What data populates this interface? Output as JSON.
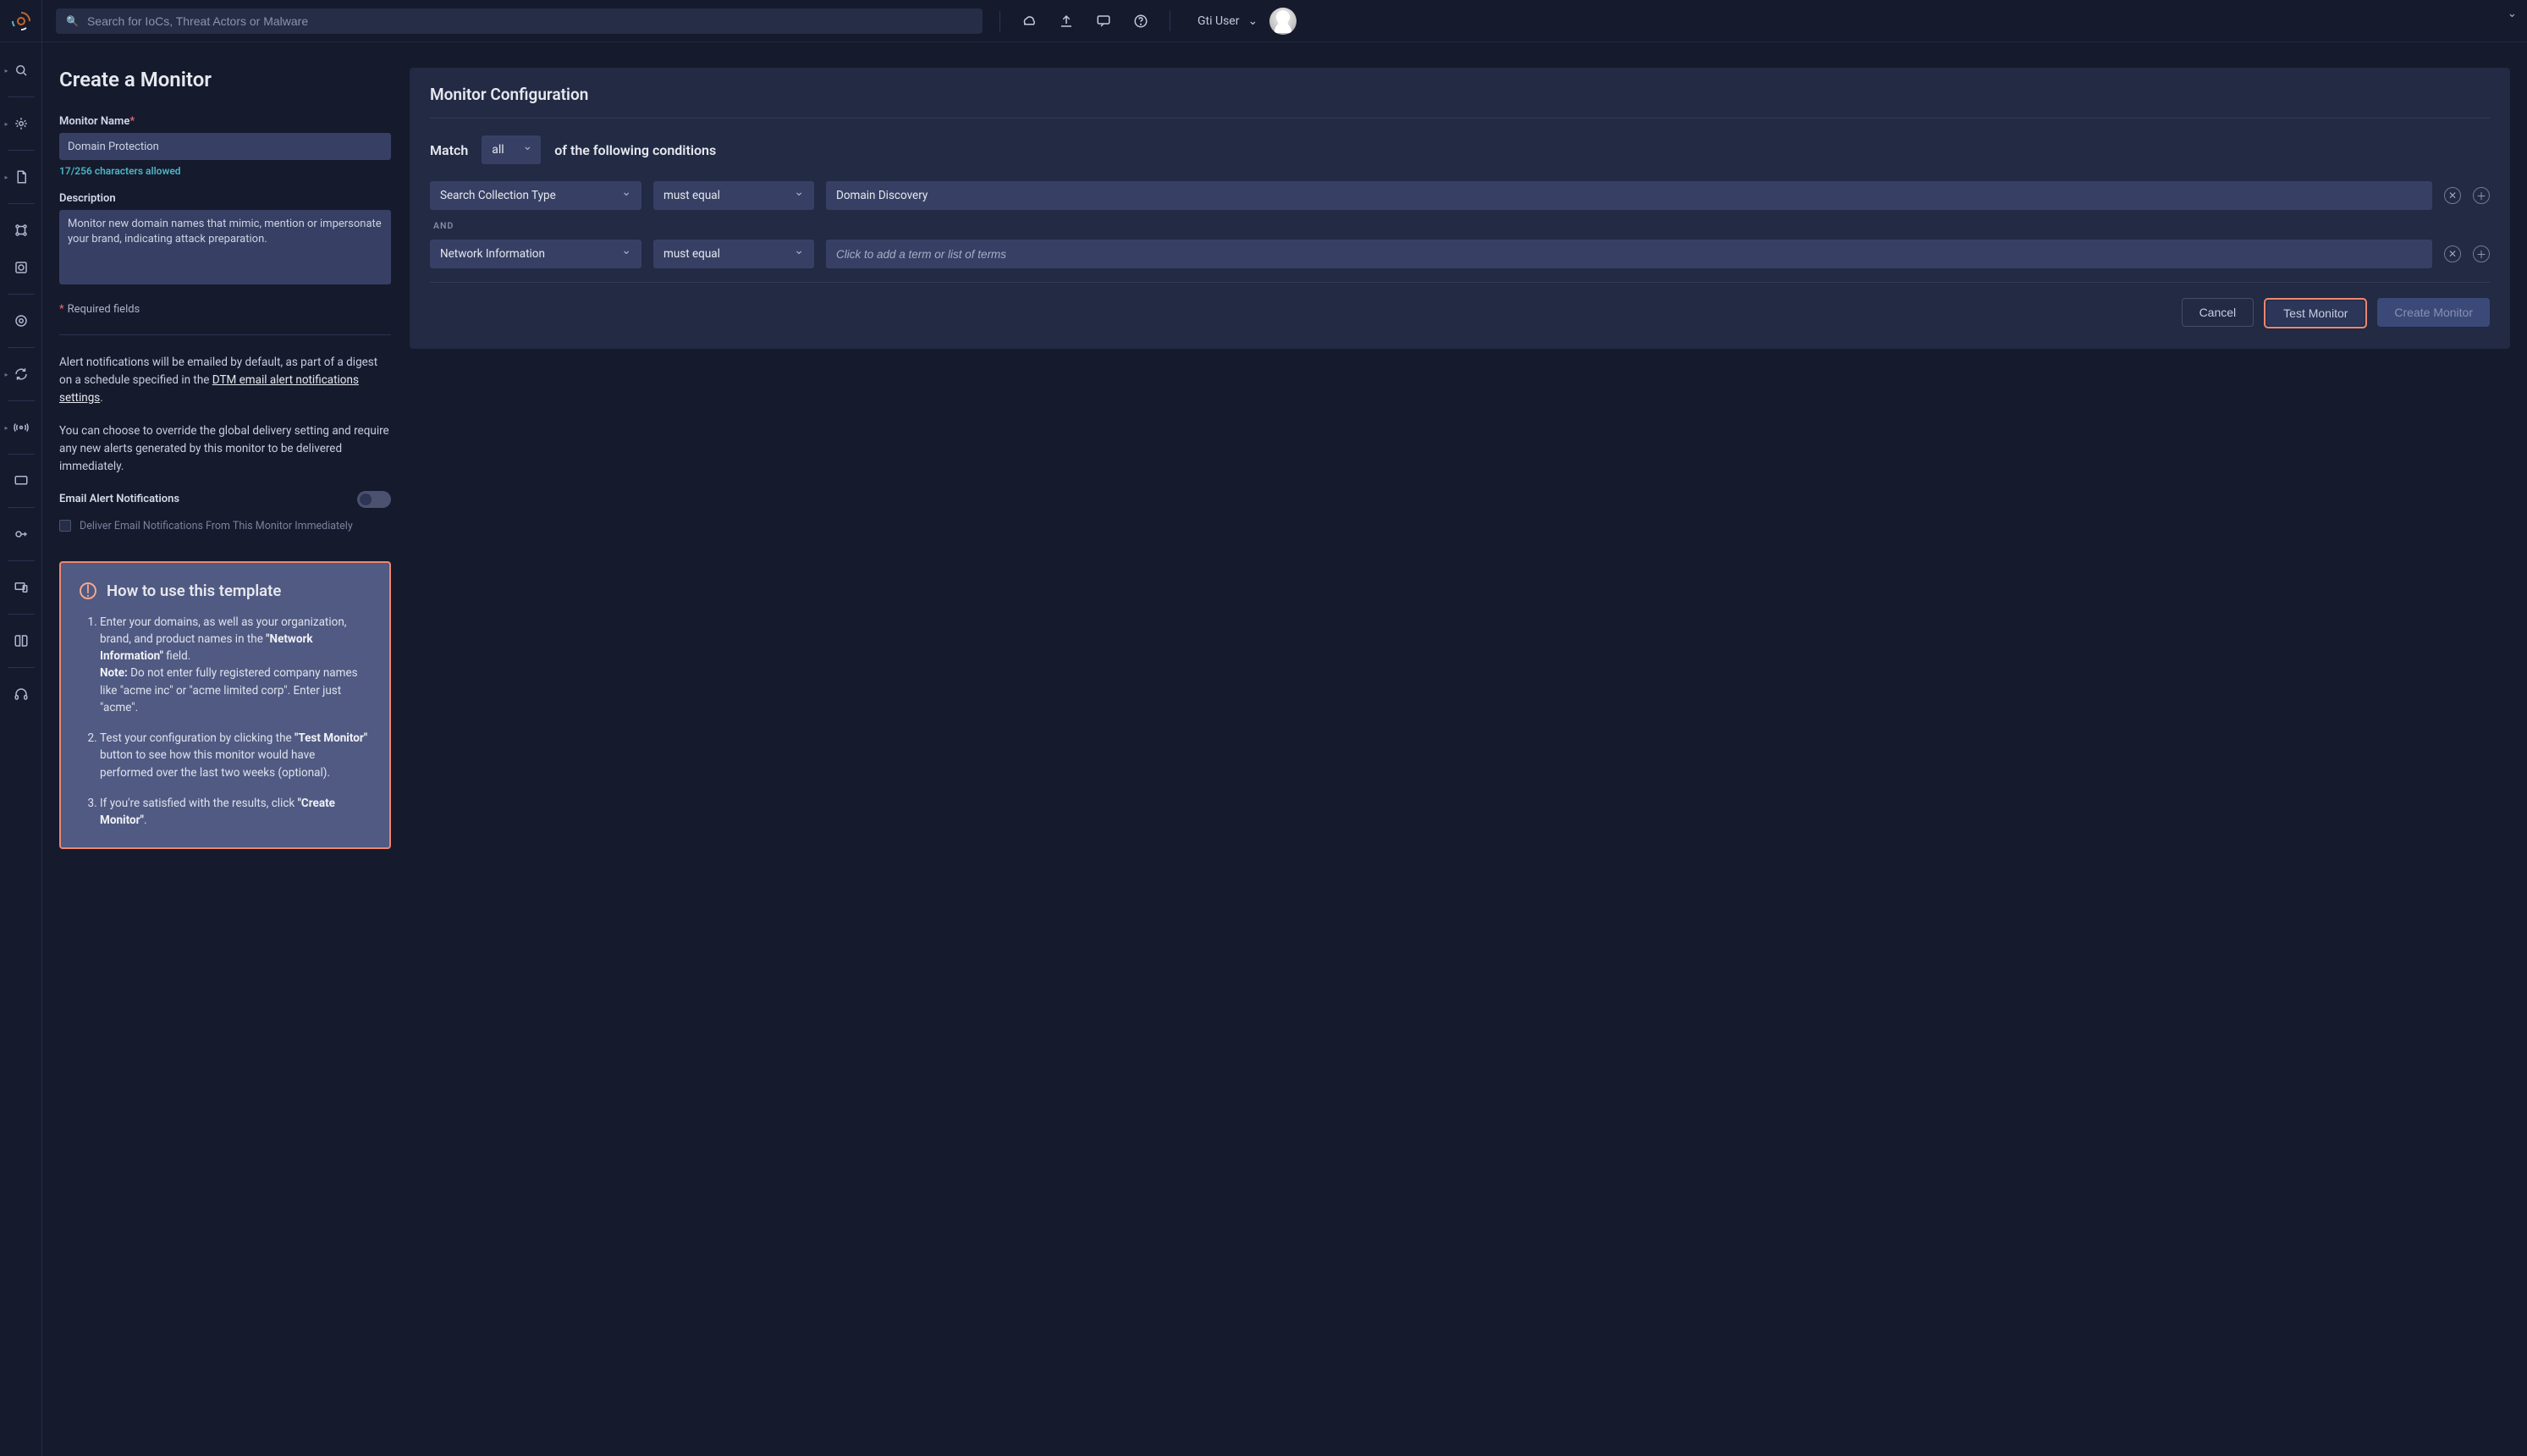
{
  "colors": {
    "accent": "#ee876f",
    "panel": "#222a44",
    "input": "#374064",
    "helpBox": "#505a82",
    "link": "#e6e8ee"
  },
  "header": {
    "search_placeholder": "Search for IoCs, Threat Actors or Malware",
    "user_name": "Gti User"
  },
  "page": {
    "title": "Create a Monitor"
  },
  "form": {
    "name_label": "Monitor Name",
    "name_value": "Domain Protection",
    "name_count": "17/256 characters allowed",
    "desc_label": "Description",
    "desc_value": "Monitor new domain names that mimic, mention or impersonate your brand, indicating attack preparation.",
    "required_note": "Required fields",
    "alert_para_prefix": "Alert notifications will be emailed by default, as part of a digest on a schedule specified in the  ",
    "alert_link": "DTM email alert notifications settings",
    "override_para": "You can choose to override the global delivery setting and require any new alerts generated by this monitor to be delivered immediately.",
    "toggle_label": "Email Alert Notifications",
    "checkbox_label": "Deliver Email Notifications From This Monitor Immediately"
  },
  "help": {
    "title": "How to use this template",
    "step1_pre": "Enter your domains, as well as your organization, brand, and product names in the ",
    "step1_bold1": "\"Network Information\"",
    "step1_post1": " field.",
    "step1_note_label": "Note:",
    "step1_note_text": " Do not enter fully registered company names like \"acme inc\" or \"acme limited corp\". Enter just \"acme\".",
    "step2_pre": "Test your configuration by clicking the ",
    "step2_bold": "\"Test Monitor\"",
    "step2_post": " button to see how this monitor would have performed over the last two weeks (optional).",
    "step3_pre": "If you're satisfied with the results, click ",
    "step3_bold": "\"Create Monitor\"",
    "step3_post": "."
  },
  "config": {
    "title": "Monitor Configuration",
    "match_pre": "Match",
    "match_value": "all",
    "match_post": "of the following conditions",
    "and_label": "AND",
    "rows": [
      {
        "field": "Search Collection Type",
        "op": "must equal",
        "value": "Domain Discovery",
        "placeholder": ""
      },
      {
        "field": "Network Information",
        "op": "must equal",
        "value": "",
        "placeholder": "Click to add a term or list of terms"
      }
    ],
    "cancel_label": "Cancel",
    "test_label": "Test Monitor",
    "create_label": "Create Monitor"
  }
}
